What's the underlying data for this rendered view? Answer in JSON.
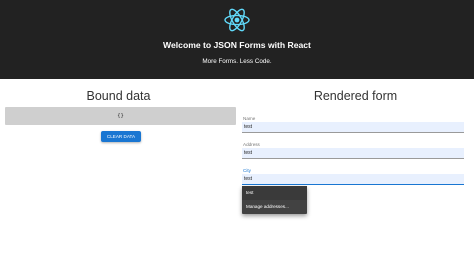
{
  "header": {
    "title": "Welcome to JSON Forms with React",
    "subtitle": "More Forms. Less Code.",
    "logo_icon": "react-logo-icon",
    "background": "#222222",
    "logo_color": "#61dafb"
  },
  "bound_data": {
    "title": "Bound data",
    "content": "{}",
    "clear_button_label": "CLEAR DATA"
  },
  "rendered_form": {
    "title": "Rendered form",
    "fields": [
      {
        "label": "Name",
        "value": "test"
      },
      {
        "label": "Address",
        "value": "test"
      },
      {
        "label": "City",
        "value": "test"
      }
    ],
    "autocomplete": {
      "options": [
        "test",
        "Manage addresses..."
      ]
    }
  },
  "colors": {
    "accent": "#1976d2",
    "autofill_bg": "#e8f0fe"
  }
}
